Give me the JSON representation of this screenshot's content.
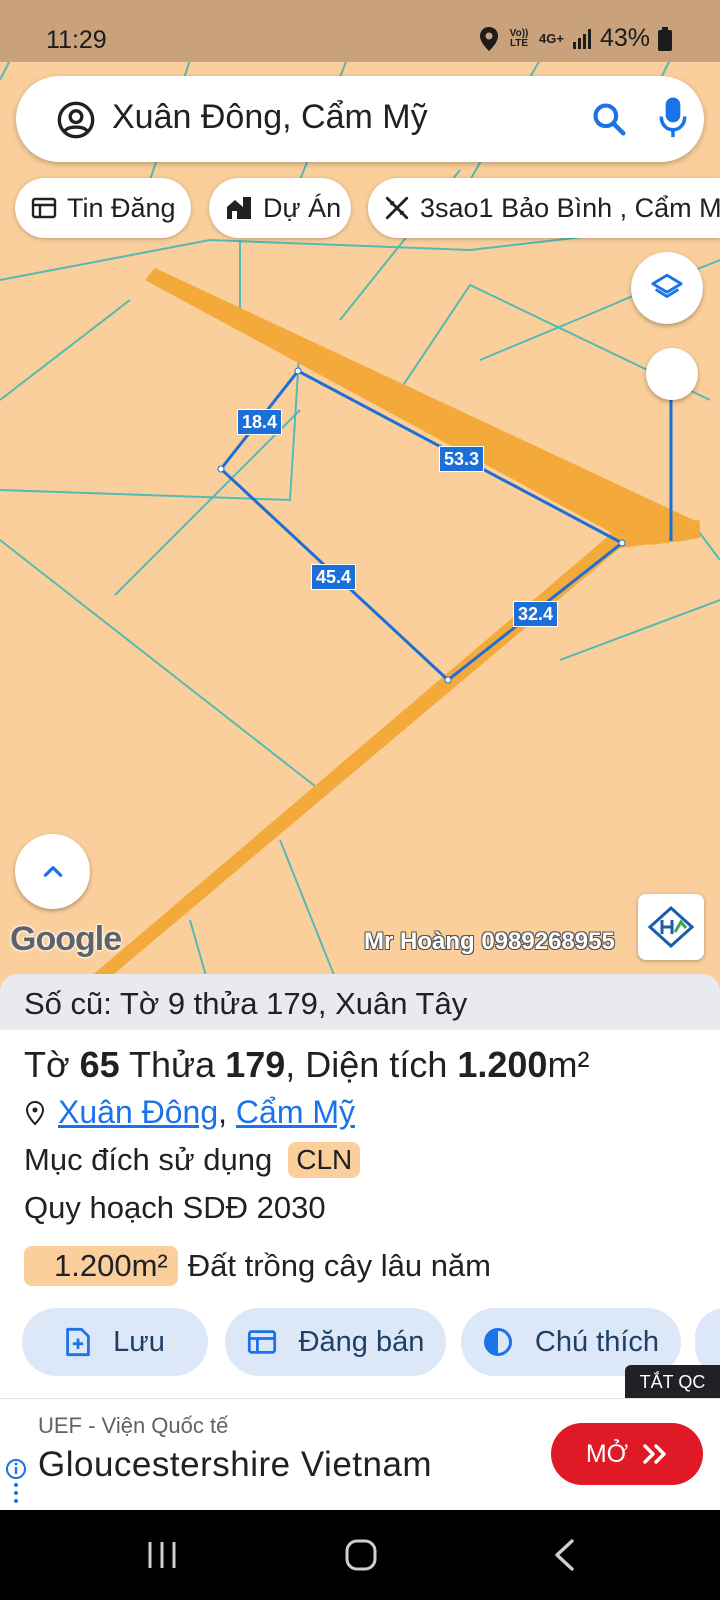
{
  "status": {
    "time": "11:29",
    "volte": "Vo)) LTE",
    "network": "4G+",
    "battery": "43%"
  },
  "search": {
    "query": "Xuân Đông, Cẩm Mỹ"
  },
  "chips": [
    {
      "label": "Tin Đăng",
      "icon": "newspaper-icon"
    },
    {
      "label": "Dự Án",
      "icon": "buildings-icon"
    },
    {
      "label": "3sao1 Bảo Bình , Cẩm M",
      "icon": "tools-icon"
    }
  ],
  "map": {
    "dimensions": [
      "18.4",
      "53.3",
      "45.4",
      "32.4"
    ],
    "google_logo": "Google",
    "watermark": "Mr Hoàng 0989268955",
    "badge_text": "HOANG THINH LAND"
  },
  "parcel": {
    "old_info": "Số cũ: Tờ 9 thửa 179, Xuân Tây",
    "to_label": "Tờ",
    "to_value": "65",
    "thua_label": "Thửa",
    "thua_value": "179",
    "area_label": ", Diện tích",
    "area_value": "1.200",
    "area_unit": "m²",
    "commune": "Xuân Đông",
    "district": "Cẩm Mỹ",
    "purpose_label": "Mục đích sử dụng",
    "purpose_code": "CLN",
    "plan_label": "Quy hoạch SDĐ 2030",
    "plan_area": "1.200m²",
    "plan_type": "Đất trồng cây lâu năm"
  },
  "actions": [
    {
      "label": "Lưu",
      "icon": "save-icon"
    },
    {
      "label": "Đăng bán",
      "icon": "listing-icon"
    },
    {
      "label": "Chú thích",
      "icon": "contrast-icon"
    }
  ],
  "ad": {
    "hide_label": "TẮT QC",
    "source": "UEF - Viện Quốc tế",
    "title": "Gloucestershire Vietnam",
    "cta": "MỞ"
  },
  "colors": {
    "map_bg": "#fbcf9b",
    "road": "#f4a93b",
    "boundary": "#1b6fd6",
    "accent": "#1a73e8",
    "cta": "#e01926"
  }
}
